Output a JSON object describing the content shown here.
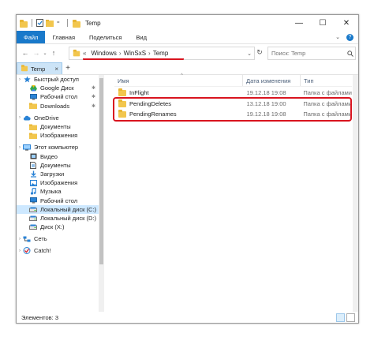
{
  "window": {
    "title": "Temp",
    "colors": {
      "accent": "#1979ca",
      "selection": "#cde8ff",
      "highlight": "#d9141f",
      "folder": "#f2c64d"
    }
  },
  "ribbon": {
    "tabs": [
      {
        "label": "Файл",
        "active": true
      },
      {
        "label": "Главная"
      },
      {
        "label": "Поделиться"
      },
      {
        "label": "Вид"
      }
    ]
  },
  "window_controls": {
    "minimize": "—",
    "maximize": "☐",
    "close": "✕"
  },
  "address": {
    "breadcrumbs": [
      {
        "label": "Windows"
      },
      {
        "label": "WinSxS"
      },
      {
        "label": "Temp"
      }
    ],
    "prefix": "«"
  },
  "search": {
    "placeholder": "Поиск: Temp"
  },
  "tabs": [
    {
      "label": "Temp"
    }
  ],
  "sidebar": {
    "items": [
      {
        "label": "Быстрый доступ",
        "icon": "star-icon",
        "indent": 0,
        "chevron": true
      },
      {
        "label": "Google Диск",
        "icon": "google-drive-icon",
        "indent": 1,
        "pinned": true
      },
      {
        "label": "Рабочий стол",
        "icon": "desktop-icon",
        "indent": 1,
        "pinned": true
      },
      {
        "label": "Downloads",
        "icon": "folder-icon",
        "indent": 1,
        "pinned": true
      },
      {
        "label": "",
        "spacer": true
      },
      {
        "label": "OneDrive",
        "icon": "cloud-icon",
        "indent": 0,
        "chevron": true
      },
      {
        "label": "Документы",
        "icon": "folder-icon",
        "indent": 1
      },
      {
        "label": "Изображения",
        "icon": "folder-icon",
        "indent": 1
      },
      {
        "label": "",
        "spacer": true
      },
      {
        "label": "Этот компьютер",
        "icon": "computer-icon",
        "indent": 0,
        "chevron": true
      },
      {
        "label": "Видео",
        "icon": "video-icon",
        "indent": 1
      },
      {
        "label": "Документы",
        "icon": "documents-icon",
        "indent": 1
      },
      {
        "label": "Загрузки",
        "icon": "download-icon",
        "indent": 1
      },
      {
        "label": "Изображения",
        "icon": "pictures-icon",
        "indent": 1
      },
      {
        "label": "Музыка",
        "icon": "music-icon",
        "indent": 1
      },
      {
        "label": "Рабочий стол",
        "icon": "desktop-icon",
        "indent": 1
      },
      {
        "label": "Локальный диск (C:)",
        "icon": "drive-icon",
        "indent": 1,
        "selected": true
      },
      {
        "label": "Локальный диск (D:)",
        "icon": "drive-icon",
        "indent": 1
      },
      {
        "label": "Диск (X:)",
        "icon": "drive-icon",
        "indent": 1
      },
      {
        "label": "",
        "spacer": true
      },
      {
        "label": "Сеть",
        "icon": "network-icon",
        "indent": 0,
        "chevron": true
      },
      {
        "label": "",
        "spacer": true
      },
      {
        "label": "Catch!",
        "icon": "catch-icon",
        "indent": 0,
        "chevron": true
      }
    ]
  },
  "list": {
    "columns": [
      {
        "label": "Имя"
      },
      {
        "label": "Дата изменения"
      },
      {
        "label": "Тип"
      }
    ],
    "rows": [
      {
        "name": "InFlight",
        "date": "19.12.18 19:08",
        "type": "Папка с файлами"
      },
      {
        "name": "PendingDeletes",
        "date": "13.12.18 19:00",
        "type": "Папка с файлами"
      },
      {
        "name": "PendingRenames",
        "date": "19.12.18 19:08",
        "type": "Папка с файлами"
      }
    ]
  },
  "status": {
    "count": "Элементов: 3"
  }
}
